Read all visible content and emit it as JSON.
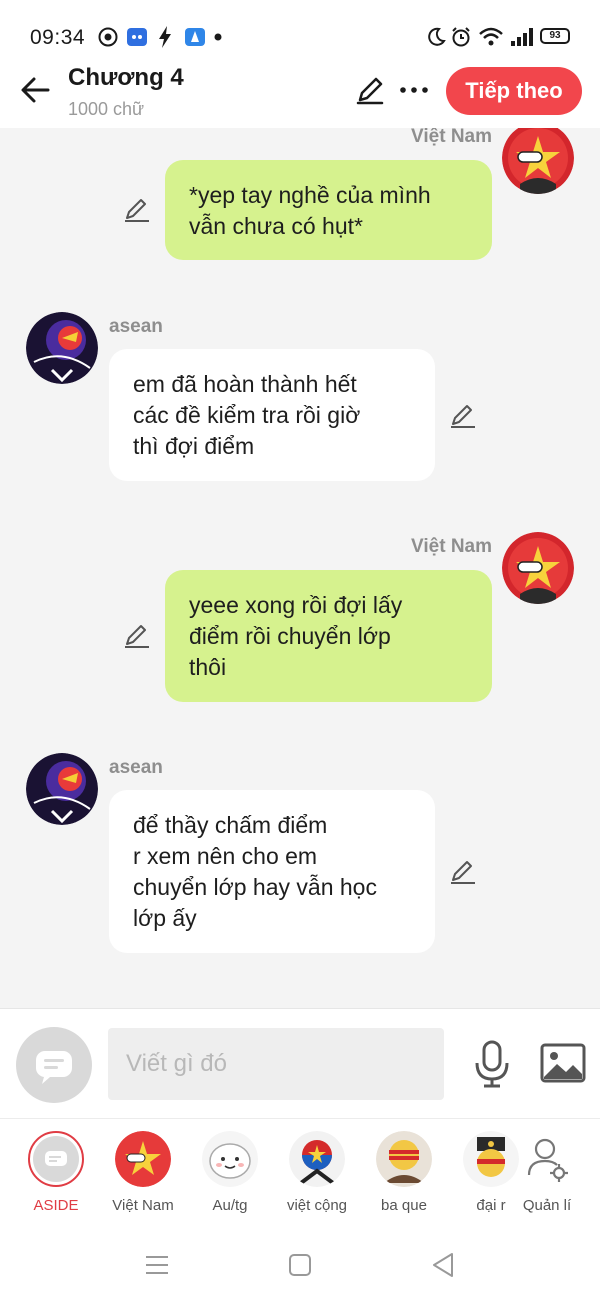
{
  "status_bar": {
    "time": "09:34",
    "battery": "93",
    "icons": [
      "compass-icon",
      "discord-icon",
      "flash-icon",
      "app-icon",
      "dot-icon",
      "moon-icon",
      "alarm-icon",
      "wifi-icon",
      "signal-icon",
      "battery-icon"
    ]
  },
  "header": {
    "title": "Chương 4",
    "subtitle": "1000 chữ",
    "next_label": "Tiếp theo",
    "icons": [
      "back-arrow-icon",
      "pencil-icon",
      "more-icon"
    ]
  },
  "messages": [
    {
      "sender": "Việt Nam",
      "side": "right",
      "text": "*yep tay nghề của mình\nvẫn chưa có hụt*"
    },
    {
      "sender": "asean",
      "side": "left",
      "text": "em đã hoàn thành hết\ncác đề kiểm tra rồi giờ\nthì đợi điểm"
    },
    {
      "sender": "Việt Nam",
      "side": "right",
      "text": "yeee xong rồi đợi lấy\nđiểm rồi chuyển lớp\nthôi"
    },
    {
      "sender": "asean",
      "side": "left",
      "text": "để thầy chấm điểm\nr xem nên cho em\nchuyển lớp hay vẫn học\nlớp ấy"
    }
  ],
  "input": {
    "placeholder": "Viết gì đó",
    "icons": [
      "chat-bubble-icon",
      "microphone-icon",
      "image-icon"
    ]
  },
  "characters": [
    {
      "name": "ASIDE",
      "selected": true
    },
    {
      "name": "Việt Nam"
    },
    {
      "name": "Au/tg"
    },
    {
      "name": "việt cộng"
    },
    {
      "name": "ba que"
    },
    {
      "name": "đại r"
    },
    {
      "name": "Quản lí"
    }
  ],
  "colors": {
    "accent": "#f2464c",
    "my_bubble": "#d6f28e",
    "other_bubble": "#ffffff",
    "background": "#f4f4f4"
  },
  "nav": {
    "icons": [
      "menu-icon",
      "home-square-icon",
      "back-triangle-icon"
    ]
  }
}
